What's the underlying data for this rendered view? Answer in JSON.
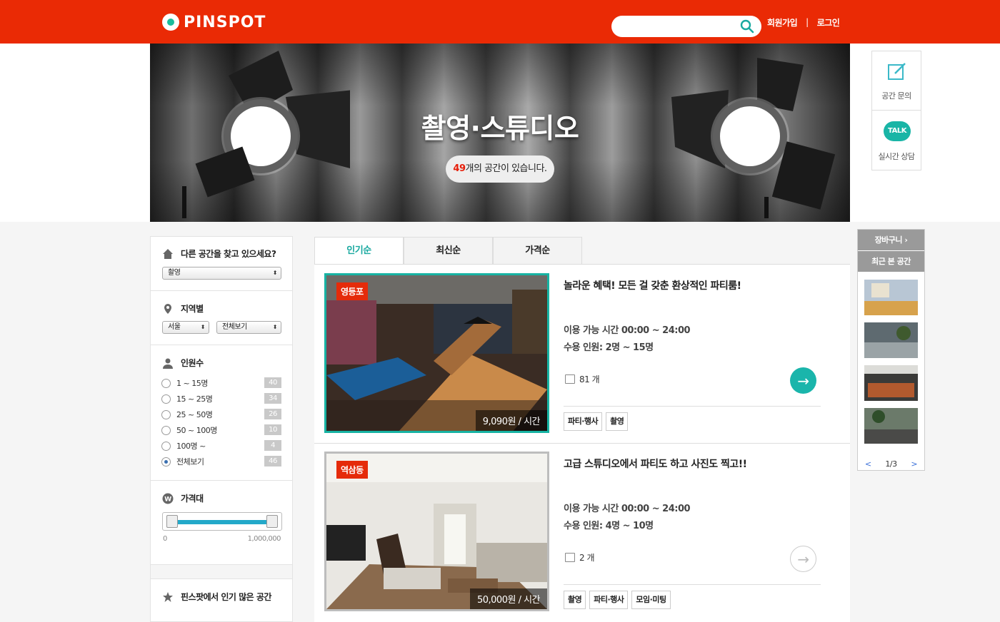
{
  "header": {
    "brand": "PINSPOT",
    "search_placeholder": "",
    "signup": "회원가입",
    "separator": "|",
    "login": "로그인",
    "brand_color": "#ea2a05"
  },
  "banner": {
    "title": "촬영·스튜디오",
    "count_num": "49",
    "count_text": "개의 공간이 있습니다."
  },
  "side_widget": {
    "inquiry": "공간 문의",
    "talk_badge": "TALK",
    "chat": "실시간 상담"
  },
  "filter": {
    "search_title": "다른 공간을 찾고 있으세요?",
    "category_value": "촬영",
    "region_title": "지역별",
    "region_city": "서울",
    "region_district": "전체보기",
    "people_title": "인원수",
    "people_options": [
      {
        "label": "1 ~ 15명",
        "count": "40",
        "selected": false
      },
      {
        "label": "15 ~ 25명",
        "count": "34",
        "selected": false
      },
      {
        "label": "25 ~ 50명",
        "count": "26",
        "selected": false
      },
      {
        "label": "50 ~ 100명",
        "count": "10",
        "selected": false
      },
      {
        "label": "100명 ~",
        "count": "4",
        "selected": false
      },
      {
        "label": "전체보기",
        "count": "46",
        "selected": true
      }
    ],
    "price_title": "가격대",
    "price_min": "0",
    "price_max": "1,000,000",
    "price_range_fraction": [
      0,
      1
    ],
    "popular_title": "핀스팟에서 인기 많은 공간"
  },
  "tabs": [
    "인기순",
    "최신순",
    "가격순"
  ],
  "listings": [
    {
      "location": "영등포",
      "price": "9,090원 / 시간",
      "title": "놀라운 혜택! 모든 걸 갖춘 환상적인 파티룸!",
      "hours": "이용 가능 시간 00:00 ~ 24:00",
      "capacity": "수용 인원: 2명 ~ 15명",
      "reviews": "81 개",
      "tags": [
        "파티·행사",
        "촬영"
      ]
    },
    {
      "location": "역삼동",
      "price": "50,000원 / 시간",
      "title": "고급 스튜디오에서 파티도 하고 사진도 찍고!!",
      "hours": "이용 가능 시간 00:00 ~ 24:00",
      "capacity": "수용 인원: 4명 ~ 10명",
      "reviews": "2 개",
      "tags": [
        "촬영",
        "파티·행사",
        "모임·미팅"
      ]
    }
  ],
  "recent": {
    "cart": "장바구니",
    "cart_arrow": "›",
    "title": "최근 본 공간",
    "prev": "<",
    "page": "1/3",
    "next": ">"
  },
  "accent_color": "#1ab5ab"
}
